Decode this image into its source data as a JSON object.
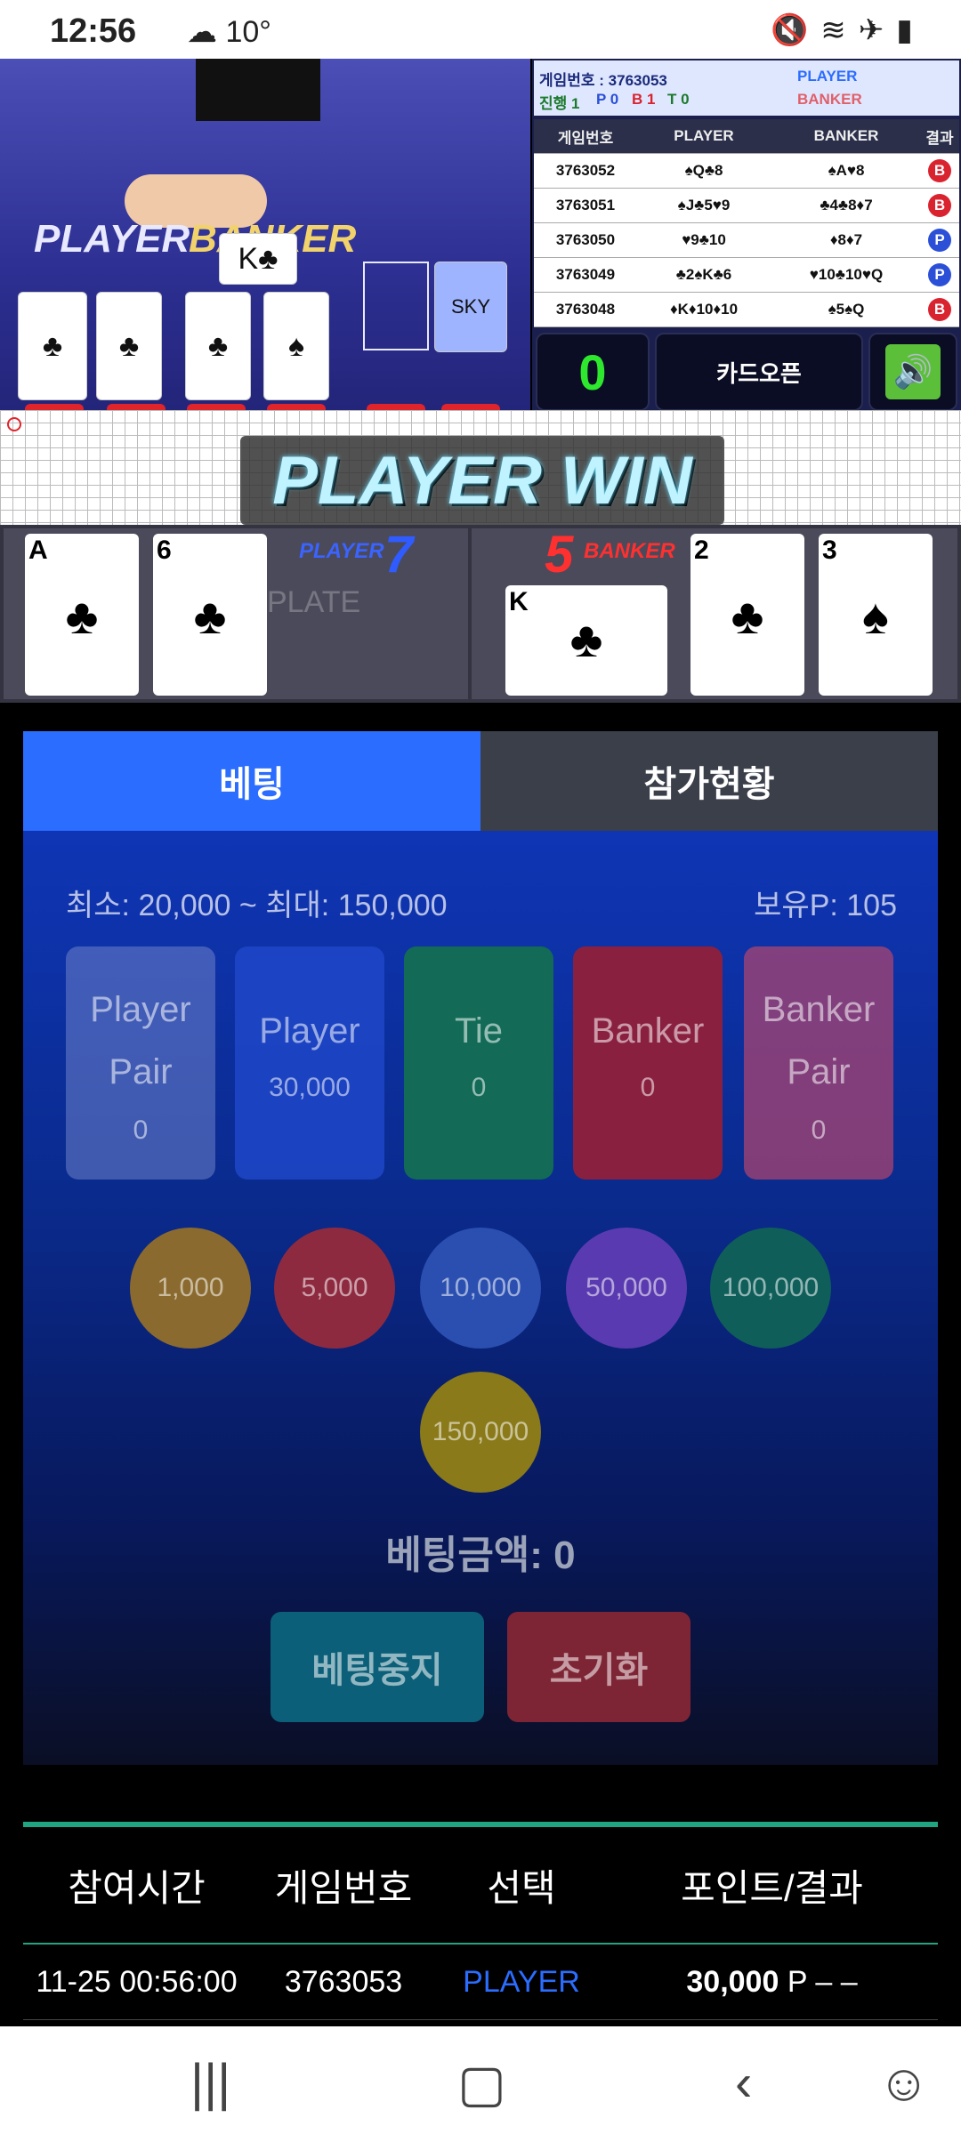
{
  "status": {
    "time": "12:56",
    "temp": "10°",
    "icons": [
      "mute-icon",
      "wifi-icon",
      "airplane-icon",
      "battery-icon"
    ]
  },
  "video": {
    "player_label": "PLAYER",
    "banker_label": "BANKER",
    "shoe_label": "SKY"
  },
  "info": {
    "game_no_label": "게임번호 : 3763053",
    "progress": "진행 1",
    "p_count": "P 0",
    "b_count": "B 1",
    "t_count": "T 0",
    "player_tag": "PLAYER",
    "banker_tag": "BANKER"
  },
  "history": {
    "headers": [
      "게임번호",
      "PLAYER",
      "BANKER",
      "결과"
    ],
    "rows": [
      {
        "no": "3763052",
        "player": "♠Q♣8",
        "banker": "♠A♥8",
        "result": "B"
      },
      {
        "no": "3763051",
        "player": "♠J♣5♥9",
        "banker": "♣4♣8♦7",
        "result": "B"
      },
      {
        "no": "3763050",
        "player": "♥9♣10",
        "banker": "♦8♦7",
        "result": "P"
      },
      {
        "no": "3763049",
        "player": "♣2♠K♣6",
        "banker": "♥10♣10♥Q",
        "result": "P"
      },
      {
        "no": "3763048",
        "player": "♦K♦10♦10",
        "banker": "♠5♠Q",
        "result": "B"
      }
    ]
  },
  "controls": {
    "counter": "0",
    "card_open": "카드오픈",
    "sound_icon": "speaker-icon"
  },
  "win_banner": "PLAYER WIN",
  "result_cards": {
    "player_label": "PLAYER",
    "player_score": "7",
    "banker_label": "BANKER",
    "banker_score": "5",
    "player_cards": [
      {
        "rank": "A",
        "suit": "♣"
      },
      {
        "rank": "6",
        "suit": "♣"
      }
    ],
    "banker_cards": [
      {
        "rank": "K",
        "suit": "♣"
      },
      {
        "rank": "2",
        "suit": "♣"
      },
      {
        "rank": "3",
        "suit": "♠"
      }
    ],
    "watermark": "PLATE"
  },
  "tabs": {
    "betting": "베팅",
    "participation": "참가현황"
  },
  "bet": {
    "limits": "최소: 20,000 ~ 최대: 150,000",
    "points": "보유P: 105",
    "boxes": [
      {
        "name_line1": "Player",
        "name_line2": "Pair",
        "amount": "0"
      },
      {
        "name_line1": "Player",
        "name_line2": "",
        "amount": "30,000"
      },
      {
        "name_line1": "Tie",
        "name_line2": "",
        "amount": "0"
      },
      {
        "name_line1": "Banker",
        "name_line2": "",
        "amount": "0"
      },
      {
        "name_line1": "Banker",
        "name_line2": "Pair",
        "amount": "0"
      }
    ],
    "chips": [
      "1,000",
      "5,000",
      "10,000",
      "50,000",
      "100,000",
      "150,000"
    ],
    "total": "베팅금액: 0",
    "stop_button": "베팅중지",
    "reset_button": "초기화"
  },
  "participation": {
    "headers": [
      "참여시간",
      "게임번호",
      "선택",
      "포인트/결과"
    ],
    "rows": [
      {
        "time": "11-25 00:56:00",
        "game_no": "3763053",
        "choice": "PLAYER",
        "points": "30,000",
        "unit": "P – –"
      }
    ]
  },
  "colors": {
    "player_blue": "#2b6dff",
    "banker_red": "#d9232f",
    "tab_active": "#2b6dff",
    "tab_inactive": "#3a3f4a",
    "accent_green": "#1fa582"
  }
}
